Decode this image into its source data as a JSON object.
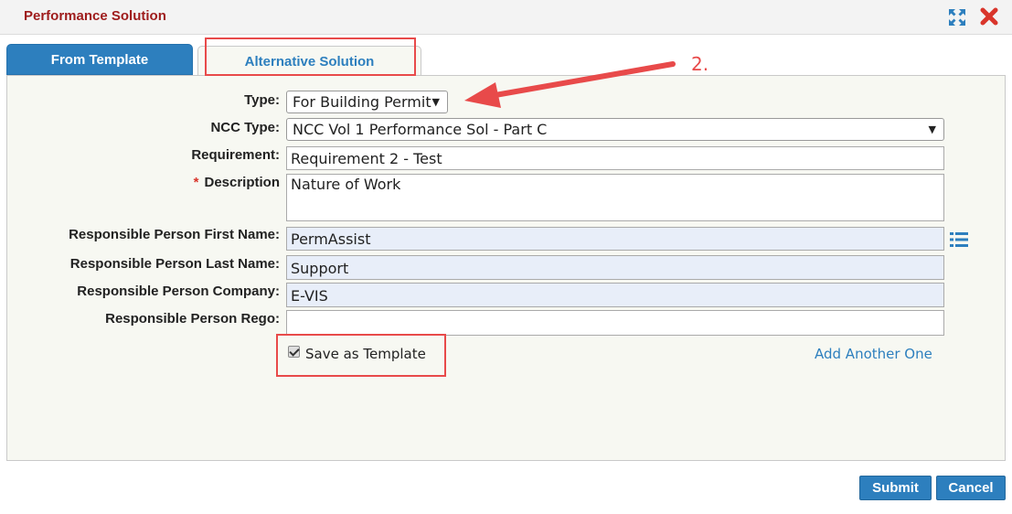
{
  "dialog": {
    "title": "Performance Solution",
    "accent_color": "#2d7fbe",
    "title_color": "#9e1b1b"
  },
  "tabs": [
    {
      "label": "From Template",
      "active": false
    },
    {
      "label": "Alternative Solution",
      "active": true
    }
  ],
  "form": {
    "type": {
      "label": "Type:",
      "value": "For Building Permit"
    },
    "ncc_type": {
      "label": "NCC Type:",
      "value": "NCC Vol 1 Performance Sol - Part C"
    },
    "requirement": {
      "label": "Requirement:",
      "value": "Requirement 2 - Test"
    },
    "description": {
      "label": "Description",
      "required_mark": "*",
      "value": "Nature of Work"
    },
    "first_name": {
      "label": "Responsible Person First Name:",
      "value": "PermAssist"
    },
    "last_name": {
      "label": "Responsible Person Last Name:",
      "value": "Support"
    },
    "company": {
      "label": "Responsible Person Company:",
      "value": "E-VIS"
    },
    "rego": {
      "label": "Responsible Person Rego:",
      "value": ""
    },
    "save_template": {
      "label": "Save as Template",
      "checked": true
    },
    "add_another": "Add Another One"
  },
  "buttons": {
    "submit": "Submit",
    "cancel": "Cancel"
  },
  "annotation": {
    "step": "2.",
    "color": "#e84a4a"
  },
  "icons": {
    "expand": "expand-icon",
    "close": "close-icon",
    "list": "list-icon"
  }
}
